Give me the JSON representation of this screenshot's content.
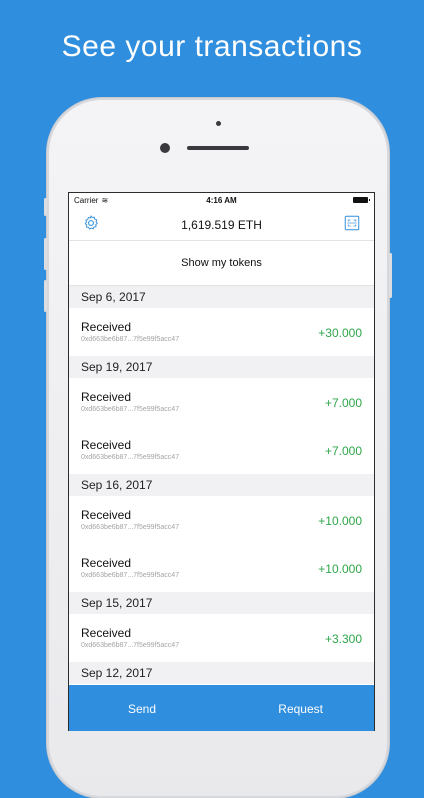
{
  "headline": "See your transactions",
  "status_bar": {
    "carrier": "Carrier",
    "time": "4:16 AM"
  },
  "nav": {
    "balance": "1,619.519 ETH",
    "settings_icon": "gear-icon",
    "scan_icon": "qr-scan-icon"
  },
  "tokens_button": "Show my tokens",
  "accent_color": "#2f8ede",
  "amount_color": "#2ea64a",
  "sections": [
    {
      "date": "Sep 6, 2017",
      "transactions": [
        {
          "type": "Received",
          "address": "0xd663be6b87...7f5e99f5acc47",
          "amount": "+30.000"
        }
      ]
    },
    {
      "date": "Sep 19, 2017",
      "transactions": [
        {
          "type": "Received",
          "address": "0xd663be6b87...7f5e99f5acc47",
          "amount": "+7.000"
        },
        {
          "type": "Received",
          "address": "0xd663be6b87...7f5e99f5acc47",
          "amount": "+7.000"
        }
      ]
    },
    {
      "date": "Sep 16, 2017",
      "transactions": [
        {
          "type": "Received",
          "address": "0xd663be6b87...7f5e99f5acc47",
          "amount": "+10.000"
        },
        {
          "type": "Received",
          "address": "0xd663be6b87...7f5e99f5acc47",
          "amount": "+10.000"
        }
      ]
    },
    {
      "date": "Sep 15, 2017",
      "transactions": [
        {
          "type": "Received",
          "address": "0xd663be6b87...7f5e99f5acc47",
          "amount": "+3.300"
        }
      ]
    },
    {
      "date": "Sep 12, 2017",
      "transactions": []
    }
  ],
  "tab_bar": {
    "send": "Send",
    "request": "Request"
  }
}
